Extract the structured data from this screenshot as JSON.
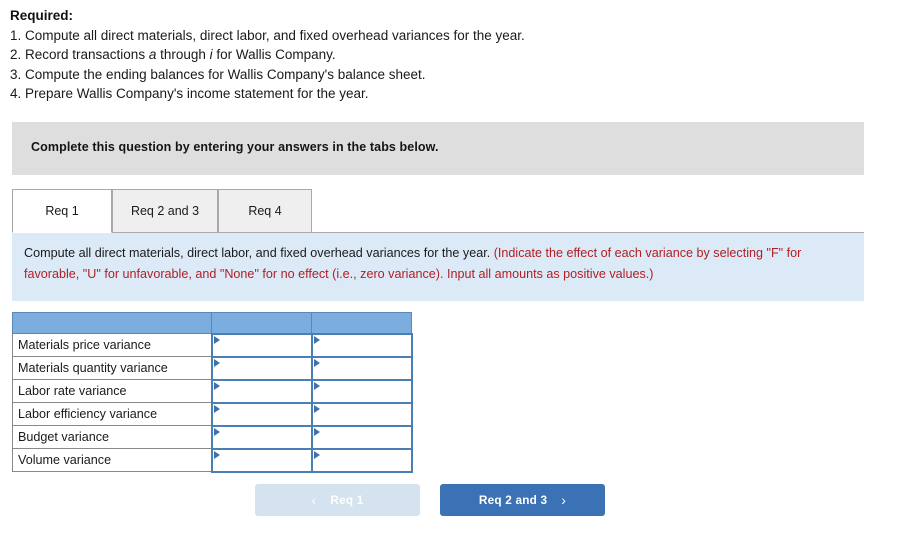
{
  "required": {
    "heading": "Required:",
    "items": [
      {
        "pre": "1. Compute all direct materials, direct labor, and fixed overhead variances for the year.",
        "ital": "",
        "post": ""
      },
      {
        "pre": "2. Record transactions ",
        "ital": "a",
        "mid": " through ",
        "ital2": "i",
        "post": " for Wallis Company."
      },
      {
        "pre": "3. Compute the ending balances for Wallis Company's balance sheet.",
        "ital": "",
        "post": ""
      },
      {
        "pre": "4. Prepare Wallis Company's income statement for the year.",
        "ital": "",
        "post": ""
      }
    ],
    "line1": "1. Compute all direct materials, direct labor, and fixed overhead variances for the year.",
    "line2_pre": "2. Record transactions ",
    "line2_ital1": "a",
    "line2_mid": " through ",
    "line2_ital2": "i",
    "line2_post": " for Wallis Company.",
    "line3": "3. Compute the ending balances for Wallis Company's balance sheet.",
    "line4": "4. Prepare Wallis Company's income statement for the year."
  },
  "banner": {
    "text": "Complete this question by entering your answers in the tabs below."
  },
  "tabs": {
    "items": [
      {
        "label": "Req 1",
        "active": true
      },
      {
        "label": "Req 2 and 3",
        "active": false
      },
      {
        "label": "Req 4",
        "active": false
      }
    ]
  },
  "instruction": {
    "black_part": "Compute all direct materials, direct labor, and fixed overhead variances for the year. ",
    "red_part": "(Indicate the effect of each variance by selecting \"F\" for favorable, \"U\" for unfavorable, and \"None\" for no effect (i.e., zero variance). Input all amounts as positive values.)"
  },
  "table": {
    "header": {
      "label_col": "",
      "amount_col": "",
      "effect_col": ""
    },
    "rows": [
      {
        "label": "Materials price variance",
        "amount": "",
        "effect": ""
      },
      {
        "label": "Materials quantity variance",
        "amount": "",
        "effect": ""
      },
      {
        "label": "Labor rate variance",
        "amount": "",
        "effect": ""
      },
      {
        "label": "Labor efficiency variance",
        "amount": "",
        "effect": ""
      },
      {
        "label": "Budget variance",
        "amount": "",
        "effect": ""
      },
      {
        "label": "Volume variance",
        "amount": "",
        "effect": ""
      }
    ]
  },
  "nav": {
    "prev_label": "Req 1",
    "prev_chevron": "‹",
    "next_label": "Req 2 and 3",
    "next_chevron": "›"
  },
  "colors": {
    "banner_gray": "#dedede",
    "instruction_blue": "#dceaf7",
    "instruction_red": "#b01f24",
    "table_header_blue": "#7badde",
    "input_border_blue": "#4a7fb5",
    "btn_active_blue": "#3a72b5",
    "btn_disabled_blue": "#d5e2ef"
  }
}
